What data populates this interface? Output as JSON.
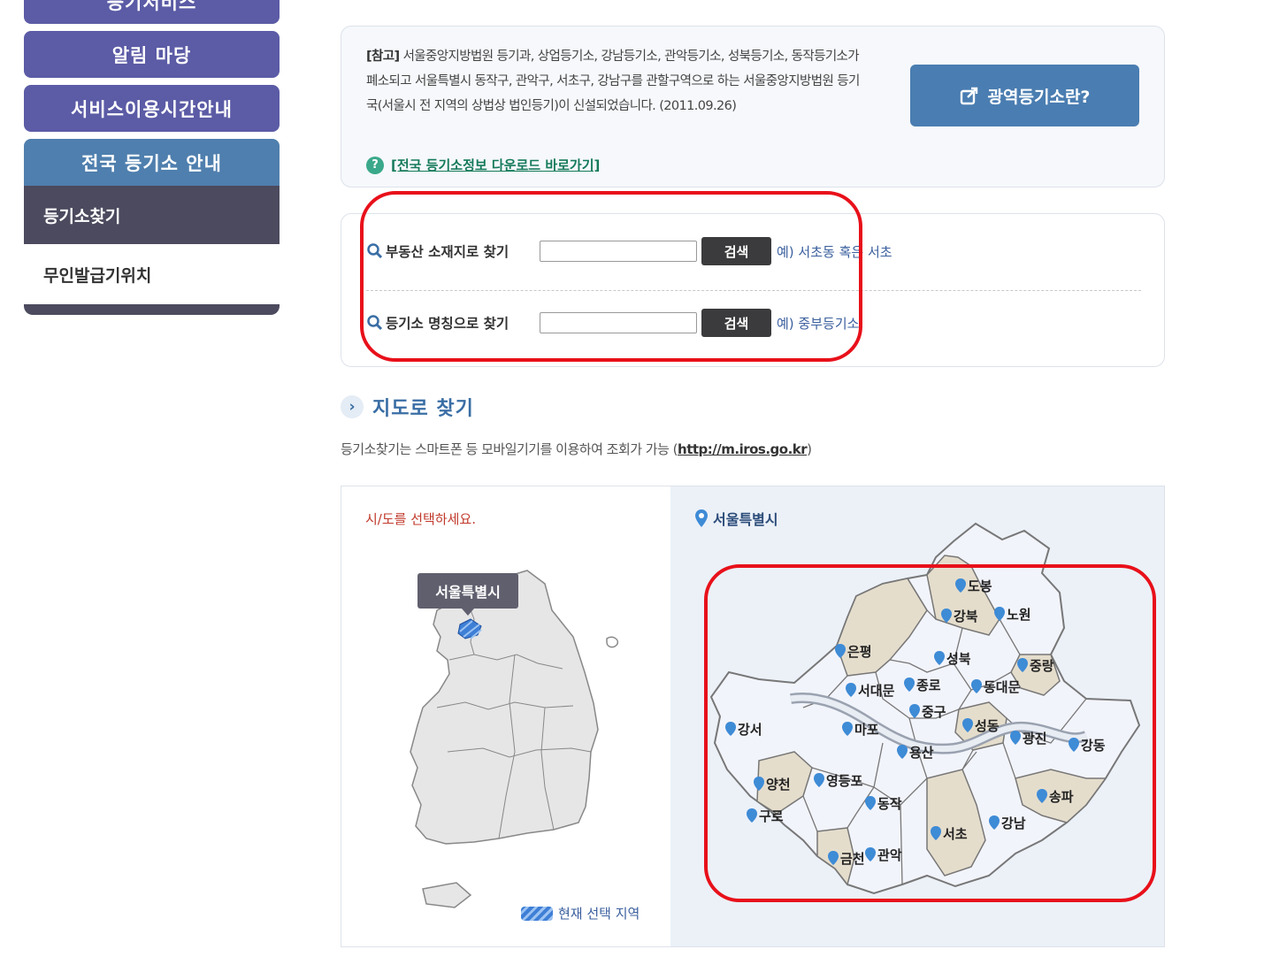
{
  "sidebar": {
    "top_label": "등기서비스",
    "alert_label": "알림 마당",
    "time_label": "서비스이용시간안내",
    "region_label": "전국 등기소 안내",
    "sub_active": "등기소찾기",
    "sub_other": "무인발급기위치"
  },
  "notice": {
    "prefix": "[참고]",
    "body": "서울중앙지방법원 등기과, 상업등기소, 강남등기소, 관악등기소, 성북등기소, 동작등기소가 폐소되고 서울특별시 동작구, 관악구, 서초구, 강남구를 관할구역으로 하는 서울중앙지방법원 등기국(서울시 전 지역의 상법상 법인등기)이 신설되었습니다. (2011.09.26)",
    "help_icon": "?",
    "link": "[전국 등기소정보 다운로드 바로가기]",
    "button": "광역등기소란?"
  },
  "search": {
    "row1_label": "부동산 소재지로 찾기",
    "row1_button": "검색",
    "row1_example": "예) 서초동 혹은 서초",
    "row2_label": "등기소 명칭으로 찾기",
    "row2_button": "검색",
    "row2_example": "예) 중부등기소"
  },
  "map": {
    "heading_icon": "›",
    "heading": "지도로 찾기",
    "desc": "등기소찾기는 스마트폰 등 모바일기기를 이용하여 조회가 가능 (",
    "desc_link": "http://m.iros.go.kr",
    "desc_end": ")",
    "select_prompt": "시/도를 선택하세요.",
    "tag": "서울특별시",
    "legend": "현재 선택 지역",
    "region_title": "서울특별시",
    "districts": [
      "도봉",
      "강북",
      "노원",
      "은평",
      "성북",
      "중랑",
      "서대문",
      "종로",
      "동대문",
      "중구",
      "강서",
      "마포",
      "성동",
      "광진",
      "강동",
      "용산",
      "양천",
      "영등포",
      "송파",
      "동작",
      "구로",
      "서초",
      "강남",
      "금천",
      "관악"
    ]
  },
  "colors": {
    "primary": "#5b5ba6",
    "accent": "#4a7db1",
    "dark": "#4b4a5e",
    "highlight": "#e8101a"
  }
}
